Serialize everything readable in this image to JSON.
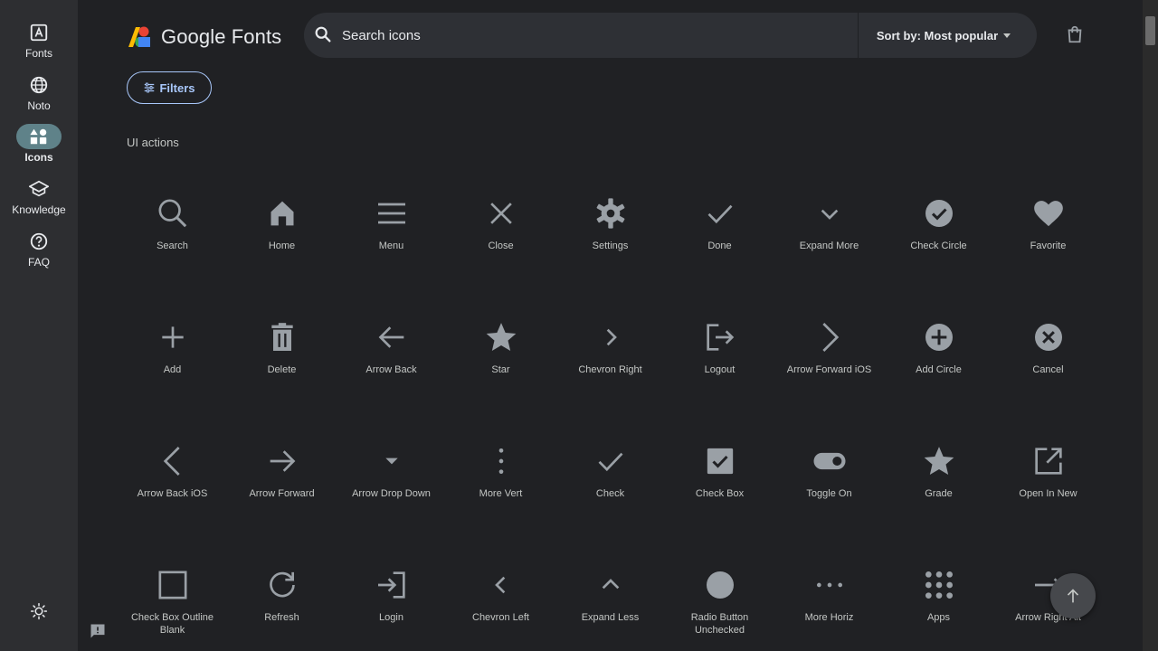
{
  "rail": {
    "items": [
      {
        "label": "Fonts",
        "icon": "fonts-icon"
      },
      {
        "label": "Noto",
        "icon": "globe-icon"
      },
      {
        "label": "Icons",
        "icon": "shapes-icon",
        "active": true
      },
      {
        "label": "Knowledge",
        "icon": "school-icon"
      },
      {
        "label": "FAQ",
        "icon": "help-icon"
      }
    ],
    "theme_icon": "sun-icon"
  },
  "header": {
    "logo_text": "Google Fonts",
    "search_placeholder": "Search icons",
    "sort_label": "Sort by: Most popular"
  },
  "filters_label": "Filters",
  "section_title": "UI actions",
  "icons": [
    [
      "Search",
      "Home",
      "Menu",
      "Close",
      "Settings",
      "Done",
      "Expand More",
      "Check Circle",
      "Favorite"
    ],
    [
      "Add",
      "Delete",
      "Arrow Back",
      "Star",
      "Chevron Right",
      "Logout",
      "Arrow Forward iOS",
      "Add Circle",
      "Cancel"
    ],
    [
      "Arrow Back iOS",
      "Arrow Forward",
      "Arrow Drop Down",
      "More Vert",
      "Check",
      "Check Box",
      "Toggle On",
      "Grade",
      "Open In New"
    ],
    [
      "Check Box Outline Blank",
      "Refresh",
      "Login",
      "Chevron Left",
      "Expand Less",
      "Radio Button Unchecked",
      "More Horiz",
      "Apps",
      "Arrow Right Alt"
    ]
  ],
  "colors": {
    "background": "#202124",
    "rail": "#2d2e31",
    "icon": "#9aa0a6",
    "accent": "#a8c7fa",
    "active_pill": "#5f8289"
  }
}
